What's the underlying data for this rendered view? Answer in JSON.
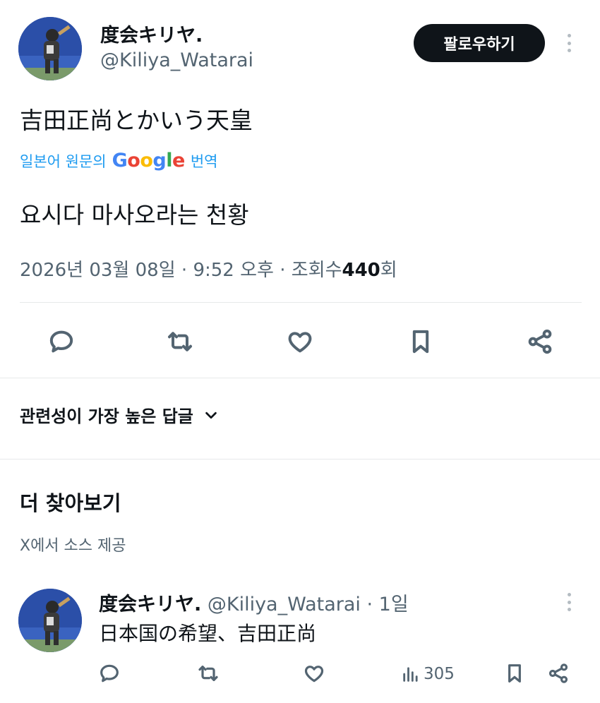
{
  "tweet": {
    "author_name": "度会キリヤ.",
    "author_handle": "@Kiliya_Watarai",
    "follow_label": "팔로우하기",
    "text": "吉田正尚とかいう天皇",
    "translate_prefix": "일본어 원문의",
    "translate_brand": "Google",
    "translate_suffix": "번역",
    "translated_text": "요시다 마사오라는 천황",
    "date": "2026년 03월 08일",
    "time": "9:52 오후",
    "views_label": "조회수",
    "views_count": "440",
    "views_suffix": "회",
    "separator": "·"
  },
  "actions": {
    "icons": [
      "reply-icon",
      "retweet-icon",
      "like-icon",
      "bookmark-icon",
      "share-icon"
    ]
  },
  "replies_sort": {
    "label": "관련성이 가장 높은 답글"
  },
  "discover": {
    "title": "더 찾아보기",
    "subtitle": "X에서 소스 제공"
  },
  "related_tweet": {
    "author_name": "度会キリヤ.",
    "author_handle": "@Kiliya_Watarai",
    "age": "1일",
    "text": "日本国の希望、吉田正尚",
    "views": "305"
  },
  "colors": {
    "primary_text": "#0f1419",
    "secondary_text": "#536471",
    "link": "#1d9bf0",
    "divider": "#e7e9ea"
  }
}
